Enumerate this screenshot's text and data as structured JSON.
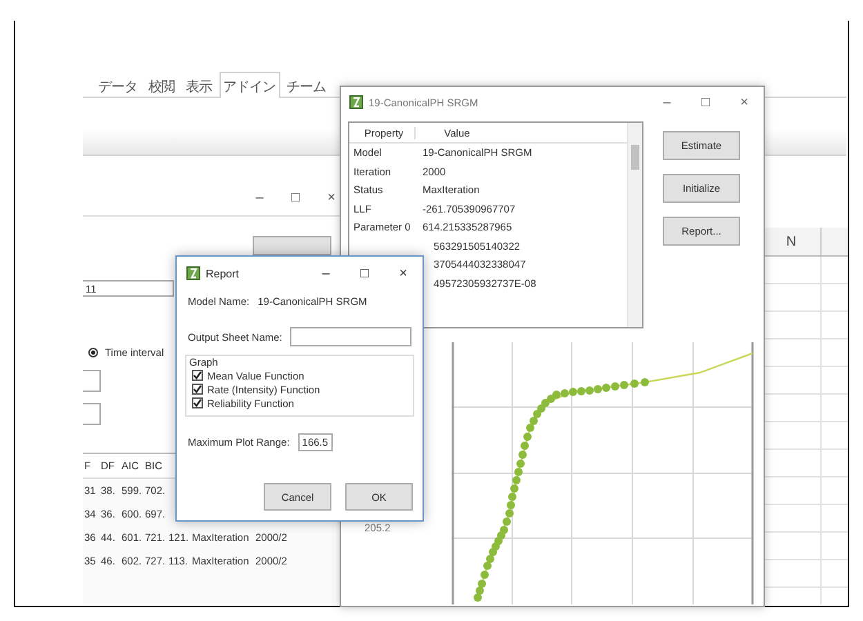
{
  "ribbon": {
    "tabs": [
      {
        "label": "データ",
        "selected": false
      },
      {
        "label": "校閲",
        "selected": false
      },
      {
        "label": "表示",
        "selected": false
      },
      {
        "label": "アドイン",
        "selected": true
      },
      {
        "label": "チーム",
        "selected": false
      }
    ]
  },
  "sheet": {
    "column_header": "N"
  },
  "main_window": {
    "window_buttons": [
      "–",
      "□",
      "×"
    ],
    "field_value": "11",
    "radio": {
      "label": "Time interval",
      "selected": true
    },
    "table": {
      "columns": [
        "F",
        "DF",
        "AIC",
        "BIC"
      ],
      "rows": [
        [
          "31",
          "38.",
          "599.",
          "702."
        ],
        [
          "34",
          "36.",
          "600.",
          "697."
        ],
        [
          "36",
          "44.",
          "601.",
          "721.",
          "121.",
          "MaxIteration",
          "2000/2"
        ],
        [
          "35",
          "46.",
          "602.",
          "727.",
          "113.",
          "MaxIteration",
          "2000/2"
        ]
      ]
    }
  },
  "model_window": {
    "title": "19-CanonicalPH SRGM",
    "window_buttons": [
      "–",
      "□",
      "×"
    ],
    "table": {
      "columns": [
        "Property",
        "Value"
      ],
      "rows": [
        {
          "property": "Model",
          "value": "19-CanonicalPH SRGM"
        },
        {
          "property": "Iteration",
          "value": "2000"
        },
        {
          "property": "Status",
          "value": "MaxIteration"
        },
        {
          "property": "LLF",
          "value": "-261.705390967707"
        },
        {
          "property": "Parameter 0",
          "value": "614.215335287965"
        },
        {
          "value": "563291505140322"
        },
        {
          "value": "3705444032338047"
        },
        {
          "value": "49572305932737E-08"
        }
      ]
    },
    "buttons": [
      "Estimate",
      "Initialize",
      "Report..."
    ],
    "chart_label": "205.2"
  },
  "report_dialog": {
    "title": "Report",
    "window_buttons": [
      "–",
      "□",
      "×"
    ],
    "model_name_label": "Model Name:",
    "model_name": "19-CanonicalPH SRGM",
    "output_sheet_label": "Output Sheet Name:",
    "graph": {
      "title": "Graph",
      "options": [
        {
          "label": "Mean Value Function",
          "checked": true
        },
        {
          "label": "Rate (Intensity) Function",
          "checked": true
        },
        {
          "label": "Reliability Function",
          "checked": true
        }
      ]
    },
    "max_range_label": "Maximum Plot Range:",
    "max_range": "166.5",
    "buttons": [
      "Cancel",
      "OK"
    ]
  }
}
